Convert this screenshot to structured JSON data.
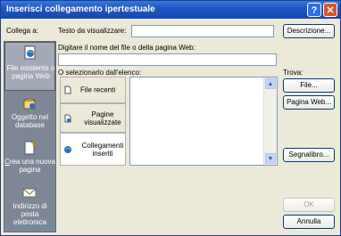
{
  "window": {
    "title": "Inserisci collegamento ipertestuale",
    "help_label": "?",
    "close_label": "✕"
  },
  "sidebar": {
    "header": "Collega a:",
    "items": [
      {
        "label": "File esistente o pagina Web",
        "icon": "web-page-icon",
        "active": true
      },
      {
        "label": "Oggetto nel database",
        "icon": "database-object-icon",
        "active": false
      },
      {
        "label": "Crea una nuova pagina",
        "icon": "new-page-icon",
        "active": false
      },
      {
        "label": "Indirizzo di posta elettronica",
        "icon": "email-icon",
        "active": false
      }
    ]
  },
  "fields": {
    "text_to_display_label": "Testo da visualizzare:",
    "text_to_display_value": "",
    "address_label": "Digitare il nome del file o della pagina Web:",
    "address_value": "",
    "select_label": "O selezionarlo dall'elenco:"
  },
  "tabs": [
    {
      "label": "File recenti",
      "icon": "recent-files-icon",
      "active": false
    },
    {
      "label": "Pagine visualizzate",
      "icon": "browsed-pages-icon",
      "active": false
    },
    {
      "label": "Collegamenti inseriti",
      "icon": "inserted-links-icon",
      "active": true
    }
  ],
  "buttons": {
    "screen_tip": "Descrizione...",
    "find_label": "Trova:",
    "file": "File...",
    "web_page": "Pagina Web...",
    "bookmark": "Segnalibro...",
    "ok": "OK",
    "cancel": "Annulla"
  },
  "colors": {
    "sidebar": "#7d8797",
    "titlebar": "#1f56c2",
    "dialog": "#ece9d8"
  }
}
